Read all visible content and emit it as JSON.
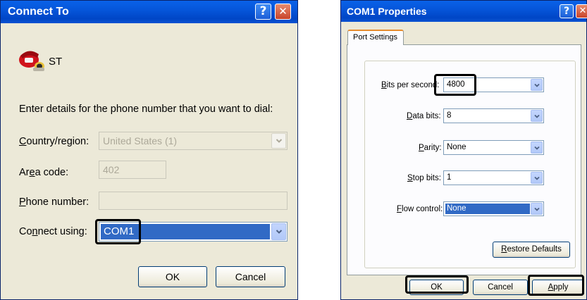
{
  "connect_to": {
    "title": "Connect To",
    "connection_name": "ST",
    "instructions": "Enter details for the phone number that you want to dial:",
    "country_label_pre": "",
    "country_label_u": "C",
    "country_label_post": "ountry/region:",
    "country_value": "United States (1)",
    "area_label_pre": "Ar",
    "area_label_u": "e",
    "area_label_post": "a code:",
    "area_value": "402",
    "phone_label_pre": "",
    "phone_label_u": "P",
    "phone_label_post": "hone number:",
    "phone_value": "",
    "connect_label_pre": "Co",
    "connect_label_u": "n",
    "connect_label_post": "nect using:",
    "connect_value": "COM1",
    "ok_label": "OK",
    "cancel_label": "Cancel"
  },
  "com1": {
    "title": "COM1 Properties",
    "tab_label": "Port Settings",
    "bits_label_pre": "",
    "bits_label_u": "B",
    "bits_label_post": "its per second:",
    "bits_value": "4800",
    "data_label_pre": "",
    "data_label_u": "D",
    "data_label_post": "ata bits:",
    "data_value": "8",
    "parity_label_pre": "",
    "parity_label_u": "P",
    "parity_label_post": "arity:",
    "parity_value": "None",
    "stop_label_pre": "",
    "stop_label_u": "S",
    "stop_label_post": "top bits:",
    "stop_value": "1",
    "flow_label_pre": "",
    "flow_label_u": "F",
    "flow_label_post": "low control:",
    "flow_value": "None",
    "restore_pre": "",
    "restore_u": "R",
    "restore_post": "estore Defaults",
    "ok_label": "OK",
    "cancel_label": "Cancel",
    "apply_pre": "",
    "apply_u": "A",
    "apply_post": "pply"
  },
  "titlebar_buttons": {
    "help": "?",
    "close": "✕"
  },
  "colors": {
    "titlebar": "#0554d8",
    "dialog_bg": "#ece9d8",
    "selection": "#316ac5",
    "highlight_box": "#000000"
  },
  "icons": [
    "phone-icon",
    "help-icon",
    "close-icon",
    "dropdown-arrow-icon"
  ]
}
